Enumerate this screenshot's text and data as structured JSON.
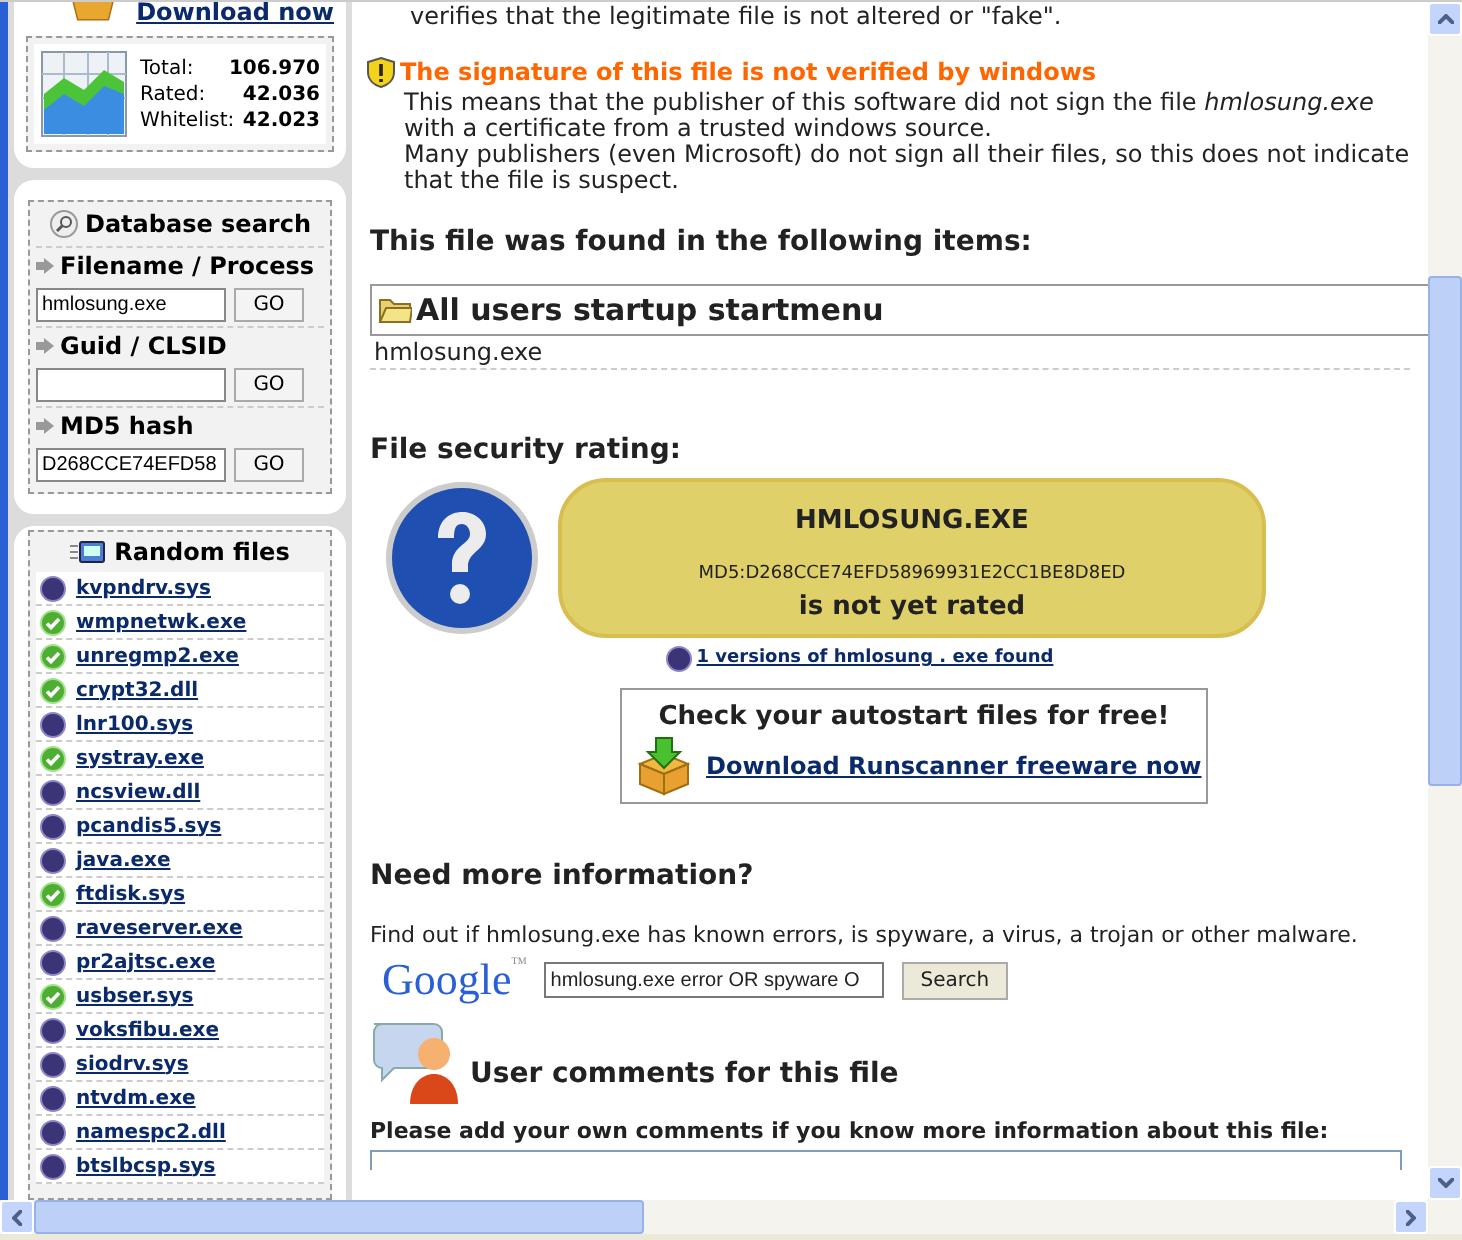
{
  "sidebar": {
    "download_link": "Download now",
    "stats": [
      {
        "label": "Total:",
        "value": "106.970"
      },
      {
        "label": "Rated:",
        "value": "42.036"
      },
      {
        "label": "Whitelist:",
        "value": "42.023"
      }
    ],
    "search": {
      "title": "Database search",
      "fields": [
        {
          "label": "Filename / Process",
          "value": "hmlosung.exe",
          "button": "GO"
        },
        {
          "label": "Guid / CLSID",
          "button": "GO"
        },
        {
          "label": "MD5 hash",
          "value": "D268CCE74EFD58",
          "button": "GO"
        }
      ]
    },
    "random_files": {
      "title": "Random files",
      "items": [
        {
          "name": "kvpndrv.sys",
          "kind": "unknown"
        },
        {
          "name": "wmpnetwk.exe",
          "kind": "safe"
        },
        {
          "name": "unregmp2.exe",
          "kind": "safe"
        },
        {
          "name": "crypt32.dll",
          "kind": "safe"
        },
        {
          "name": "lnr100.sys",
          "kind": "unknown"
        },
        {
          "name": "systray.exe",
          "kind": "safe"
        },
        {
          "name": "ncsview.dll",
          "kind": "unknown"
        },
        {
          "name": "pcandis5.sys",
          "kind": "unknown"
        },
        {
          "name": "java.exe",
          "kind": "unknown"
        },
        {
          "name": "ftdisk.sys",
          "kind": "safe"
        },
        {
          "name": "raveserver.exe",
          "kind": "unknown"
        },
        {
          "name": "pr2ajtsc.exe",
          "kind": "unknown"
        },
        {
          "name": "usbser.sys",
          "kind": "safe"
        },
        {
          "name": "voksfibu.exe",
          "kind": "unknown"
        },
        {
          "name": "siodrv.sys",
          "kind": "unknown"
        },
        {
          "name": "ntvdm.exe",
          "kind": "unknown"
        },
        {
          "name": "namespc2.dll",
          "kind": "unknown"
        },
        {
          "name": "btslbcsp.sys",
          "kind": "unknown"
        }
      ]
    }
  },
  "main": {
    "intro_tail": "verifies that the legitimate file is not altered or \"fake\".",
    "signature": {
      "title": "The signature of this file is not verified by windows",
      "lines": [
        "This means that the publisher of this software did not sign the file *hmlosung.exe*",
        "with a certificate from a trusted windows source.",
        "Many publishers (even Microsoft) do not sign all their files, so this does not indicate",
        "that the file is suspect."
      ]
    },
    "found": {
      "heading": "This file was found in the following items:",
      "group": "All users startup startmenu",
      "items": [
        "hmlosung.exe"
      ]
    },
    "rating": {
      "heading": "File security rating:",
      "filename": "HMLOSUNG.EXE",
      "md5": "MD5:D268CCE74EFD58969931E2CC1BE8D8ED",
      "status": "is not yet rated",
      "versions_link": "1 versions of hmlosung . exe found"
    },
    "autostart": {
      "title": "Check your autostart files for free!",
      "link": "Download Runscanner freeware now"
    },
    "more_info": {
      "heading": "Need more information?",
      "text": "Find out if hmlosung.exe has known errors, is spyware, a virus, a trojan or other malware.",
      "query": "hmlosung.exe error OR spyware O",
      "button": "Search",
      "logo": "Google",
      "logo_tm": "TM"
    },
    "comments": {
      "heading": "User comments for this file",
      "prompt": "Please add your own comments if you know more information about this file:"
    }
  }
}
